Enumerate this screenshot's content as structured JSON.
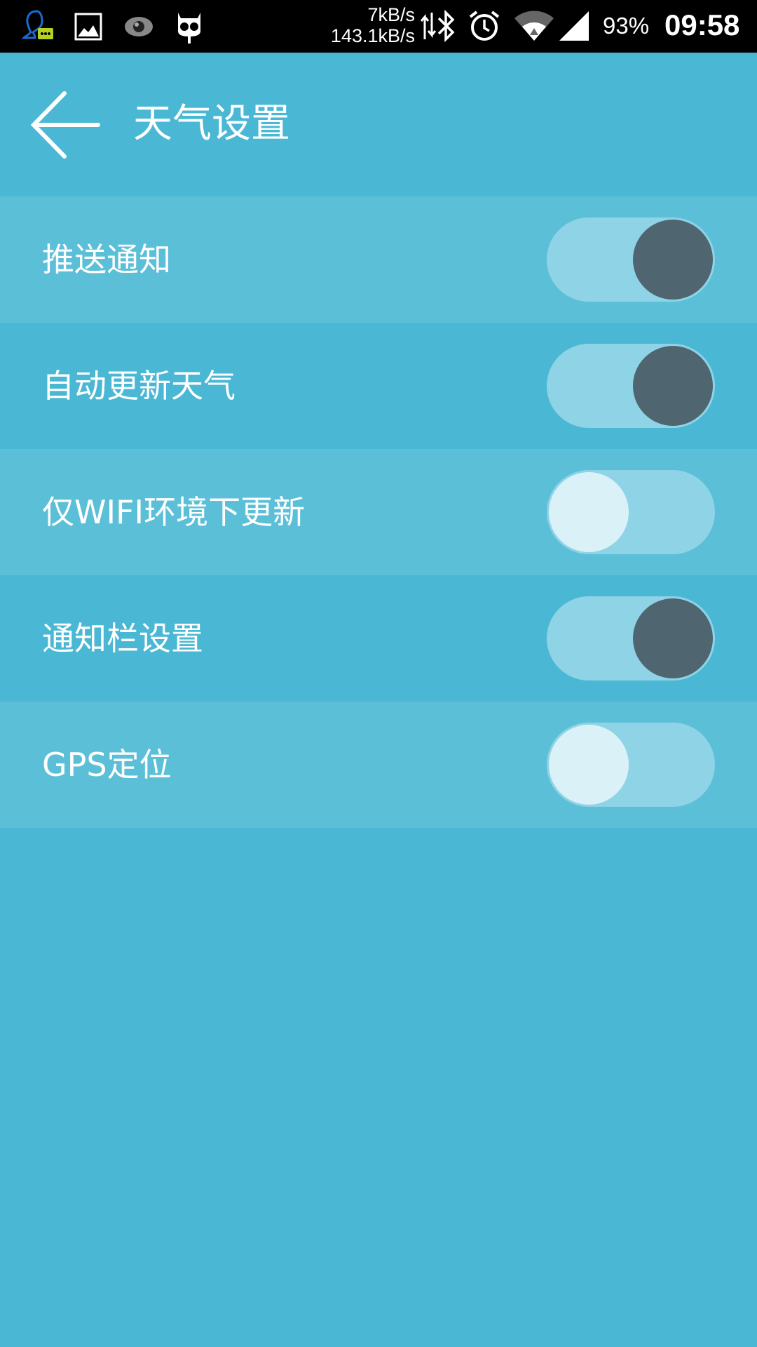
{
  "status_bar": {
    "icons_left": [
      "chat-app-icon",
      "gallery-icon",
      "eye-icon",
      "robot-icon"
    ],
    "net_speed_up": "7kB/s",
    "net_speed_down": "143.1kB/s",
    "icons_right": [
      "data-transfer-icon",
      "bluetooth-icon",
      "alarm-icon",
      "wifi-icon",
      "cellular-signal-icon"
    ],
    "battery": "93%",
    "time": "09:58"
  },
  "app_bar": {
    "back_icon": "arrow-left-icon",
    "title": "天气设置"
  },
  "settings": [
    {
      "label": "推送通知",
      "enabled": true
    },
    {
      "label": "自动更新天气",
      "enabled": true
    },
    {
      "label": "仅WIFI环境下更新",
      "enabled": false
    },
    {
      "label": "通知栏设置",
      "enabled": true
    },
    {
      "label": "GPS定位",
      "enabled": false
    }
  ],
  "colors": {
    "background": "#4ab8d4",
    "row_alt": "#5cbfd8",
    "toggle_track": "#8fd3e6",
    "knob_on": "#4f6670",
    "knob_off": "#daf1f8",
    "text": "#ffffff"
  }
}
